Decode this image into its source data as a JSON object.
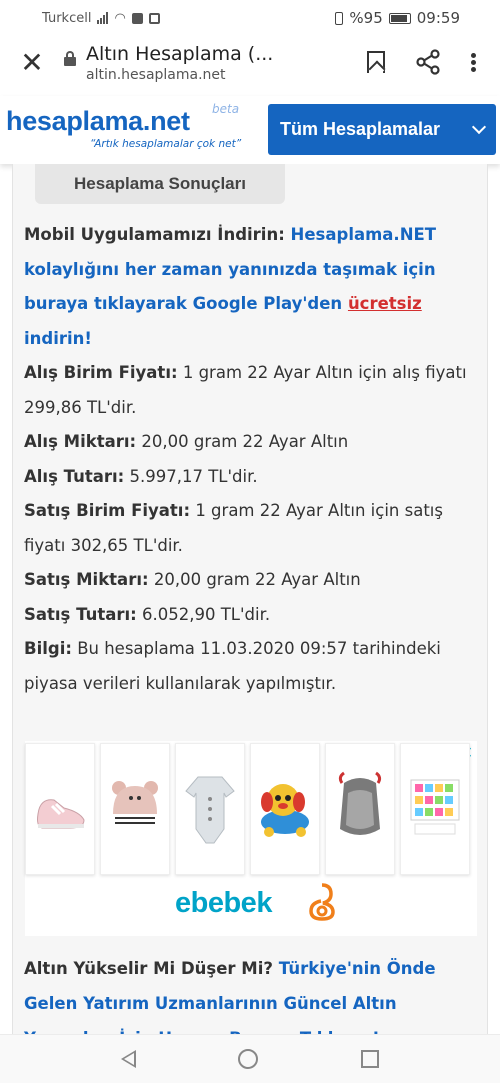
{
  "status_bar": {
    "carrier": "Turkcell",
    "battery_percent": "%95",
    "time": "09:59"
  },
  "browser": {
    "title": "Altın Hesaplama (...",
    "host": "altin.hesaplama.net"
  },
  "site": {
    "logo_text": "hesaplama.net",
    "logo_beta": "beta",
    "slogan": "“Artık hesaplamalar çok net”",
    "all_calcs_label": "Tüm Hesaplamalar"
  },
  "results": {
    "tab_label": "Hesaplama Sonuçları",
    "app_promo_label": "Mobil Uygulamamızı İndirin:",
    "app_promo_link1": "Hesaplama.NET kolaylığını her zaman yanınızda taşımak için buraya tıklayarak Google Play'den",
    "app_promo_free": "ücretsiz",
    "app_promo_link2": "indirin!",
    "rows": [
      {
        "label": "Alış Birim Fiyatı:",
        "value": "1 gram 22 Ayar Altın için alış fiyatı 299,86 TL'dir."
      },
      {
        "label": "Alış Miktarı:",
        "value": "20,00 gram 22 Ayar Altın"
      },
      {
        "label": "Alış Tutarı:",
        "value": "5.997,17 TL'dir."
      },
      {
        "label": "Satış Birim Fiyatı:",
        "value": "1 gram 22 Ayar Altın için satış fiyatı 302,65 TL'dir."
      },
      {
        "label": "Satış Miktarı:",
        "value": "20,00 gram 22 Ayar Altın"
      },
      {
        "label": "Satış Tutarı:",
        "value": "6.052,90 TL'dir."
      },
      {
        "label": "Bilgi:",
        "value": "Bu hesaplama 11.03.2020 09:57 tarihindeki piyasa verileri kullanılarak yapılmıştır."
      }
    ]
  },
  "ad": {
    "brand": "ebebek",
    "info_icon": "i",
    "close_icon": "✕",
    "products": [
      "baby-shoe-icon",
      "baby-hat-icon",
      "baby-romper-icon",
      "toy-dog-icon",
      "baby-carrier-icon",
      "flash-cards-icon"
    ]
  },
  "cta": {
    "question": "Altın Yükselir Mi Düşer Mi?",
    "link": "Türkiye'nin Önde Gelen Yatırım Uzmanlarının Güncel Altın Yorumları İçin Hemen Buraya Tıklayın!"
  },
  "colors": {
    "brand_blue": "#1565c0",
    "link_red": "#d32f2f",
    "ad_teal": "#00a3c8"
  }
}
